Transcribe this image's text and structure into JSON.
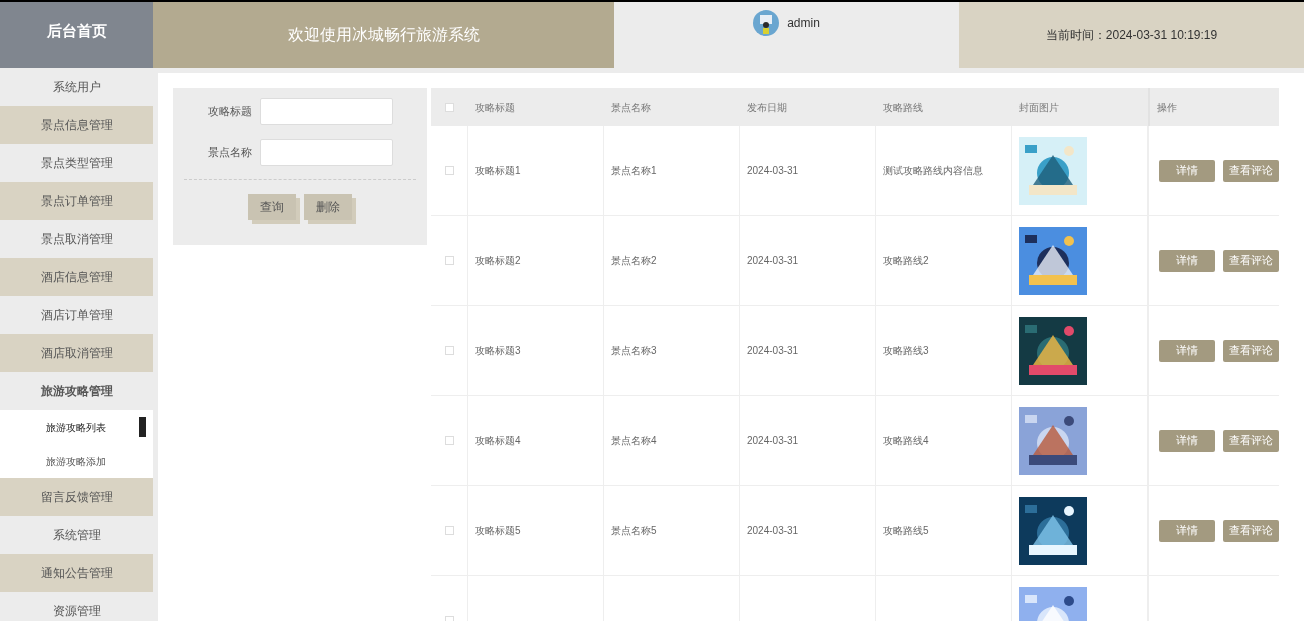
{
  "header": {
    "home": "后台首页",
    "title": "欢迎使用冰城畅行旅游系统",
    "user": "admin",
    "time_label": "当前时间：",
    "time": "2024-03-31 10:19:19"
  },
  "sidebar": {
    "items": [
      {
        "label": "系统用户",
        "expanded": false
      },
      {
        "label": "景点信息管理",
        "expanded": false
      },
      {
        "label": "景点类型管理",
        "expanded": false
      },
      {
        "label": "景点订单管理",
        "expanded": false
      },
      {
        "label": "景点取消管理",
        "expanded": false
      },
      {
        "label": "酒店信息管理",
        "expanded": false
      },
      {
        "label": "酒店订单管理",
        "expanded": false
      },
      {
        "label": "酒店取消管理",
        "expanded": false
      },
      {
        "label": "旅游攻略管理",
        "expanded": true,
        "children": [
          {
            "label": "旅游攻略列表",
            "selected": true
          },
          {
            "label": "旅游攻略添加",
            "selected": false
          }
        ]
      },
      {
        "label": "留言反馈管理",
        "expanded": false
      },
      {
        "label": "系统管理",
        "expanded": false
      },
      {
        "label": "通知公告管理",
        "expanded": false
      },
      {
        "label": "资源管理",
        "expanded": false
      }
    ]
  },
  "search": {
    "fields": [
      {
        "label": "攻略标题"
      },
      {
        "label": "景点名称"
      }
    ],
    "buttons": [
      "查询",
      "删除"
    ]
  },
  "table": {
    "all_checked": false,
    "columns": [
      "攻略标题",
      "景点名称",
      "发布日期",
      "攻略路线",
      "封面图片",
      "操作"
    ],
    "rows": [
      {
        "checked": false,
        "title": "攻略标题1",
        "spot": "景点名称1",
        "date": "2024-03-31",
        "route": "测试攻略路线内容信息",
        "actions": [
          "详情",
          "查看评论"
        ]
      },
      {
        "checked": false,
        "title": "攻略标题2",
        "spot": "景点名称2",
        "date": "2024-03-31",
        "route": "攻略路线2",
        "actions": [
          "详情",
          "查看评论"
        ]
      },
      {
        "checked": false,
        "title": "攻略标题3",
        "spot": "景点名称3",
        "date": "2024-03-31",
        "route": "攻略路线3",
        "actions": [
          "详情",
          "查看评论"
        ]
      },
      {
        "checked": false,
        "title": "攻略标题4",
        "spot": "景点名称4",
        "date": "2024-03-31",
        "route": "攻略路线4",
        "actions": [
          "详情",
          "查看评论"
        ]
      },
      {
        "checked": false,
        "title": "攻略标题5",
        "spot": "景点名称5",
        "date": "2024-03-31",
        "route": "攻略路线5",
        "actions": [
          "详情",
          "查看评论"
        ]
      },
      {
        "checked": false,
        "actions": []
      }
    ]
  }
}
